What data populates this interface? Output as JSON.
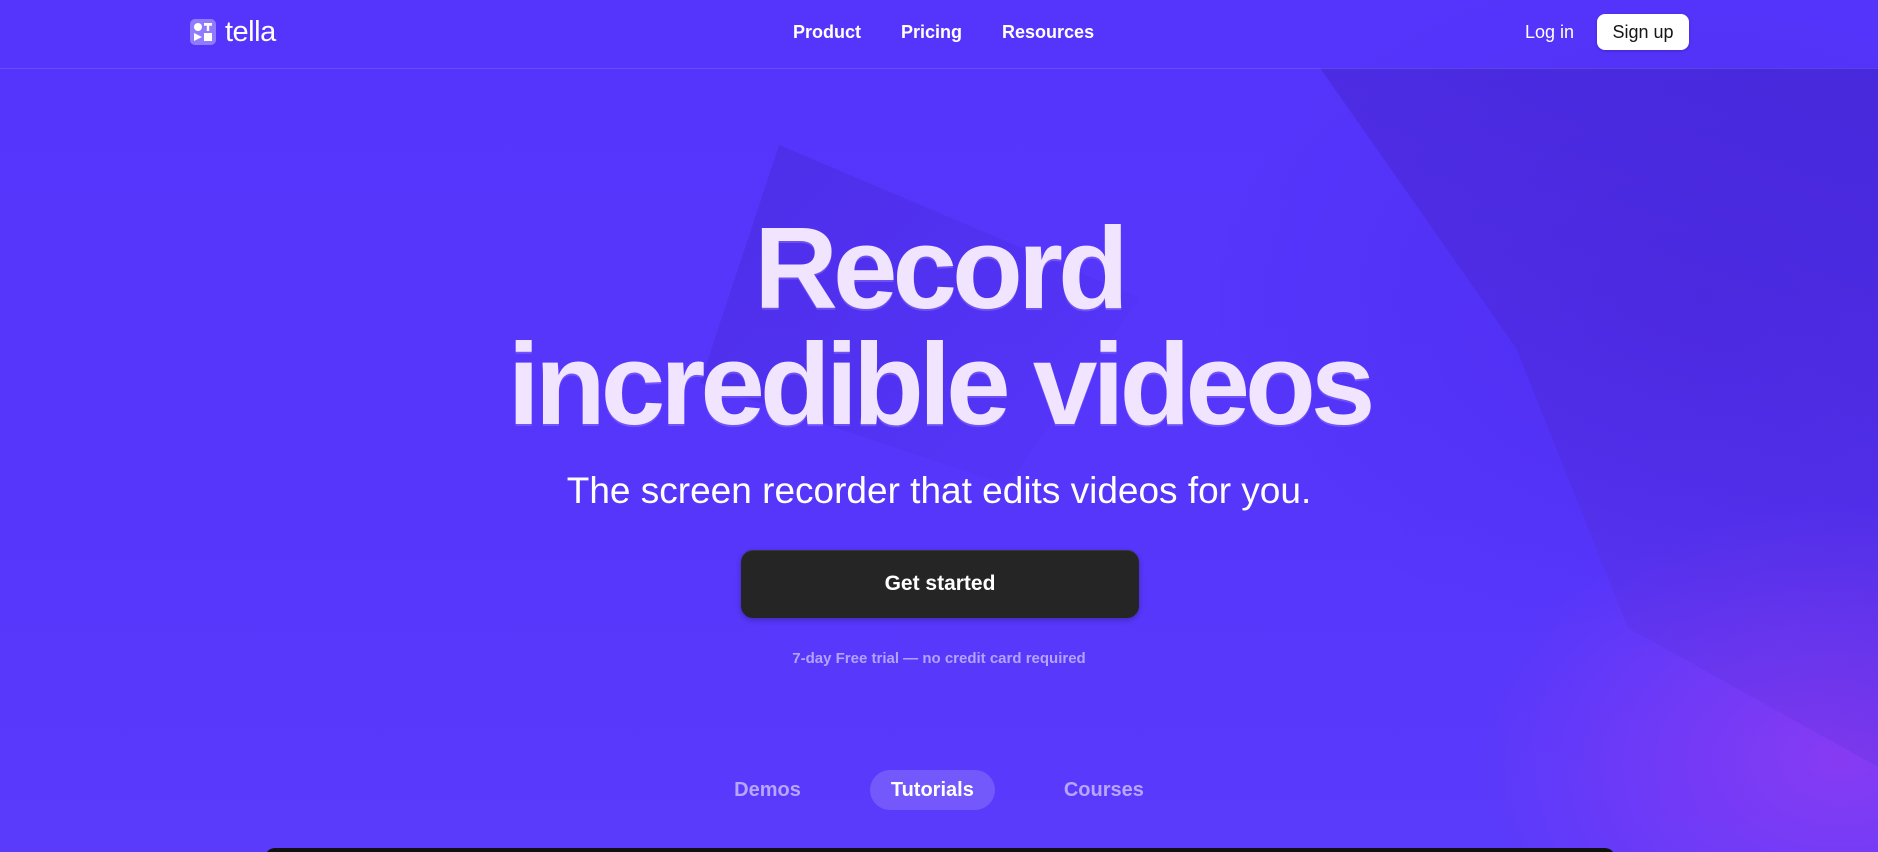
{
  "brand": {
    "name": "tella",
    "logo_icon": "tella-logo-icon"
  },
  "nav": {
    "links": [
      "Product",
      "Pricing",
      "Resources"
    ],
    "login_label": "Log in",
    "signup_label": "Sign up"
  },
  "hero": {
    "title_line1": "Record",
    "title_line2": "incredible videos",
    "subtitle": "The screen recorder that edits videos for you.",
    "cta_label": "Get started",
    "trial_note": "7-day Free trial — no credit card required"
  },
  "tabs": {
    "items": [
      "Demos",
      "Tutorials",
      "Courses"
    ],
    "active": "Tutorials"
  },
  "colors": {
    "background": "#5535fb",
    "cta_background": "#252525",
    "title_text": "#f0e4ff"
  }
}
